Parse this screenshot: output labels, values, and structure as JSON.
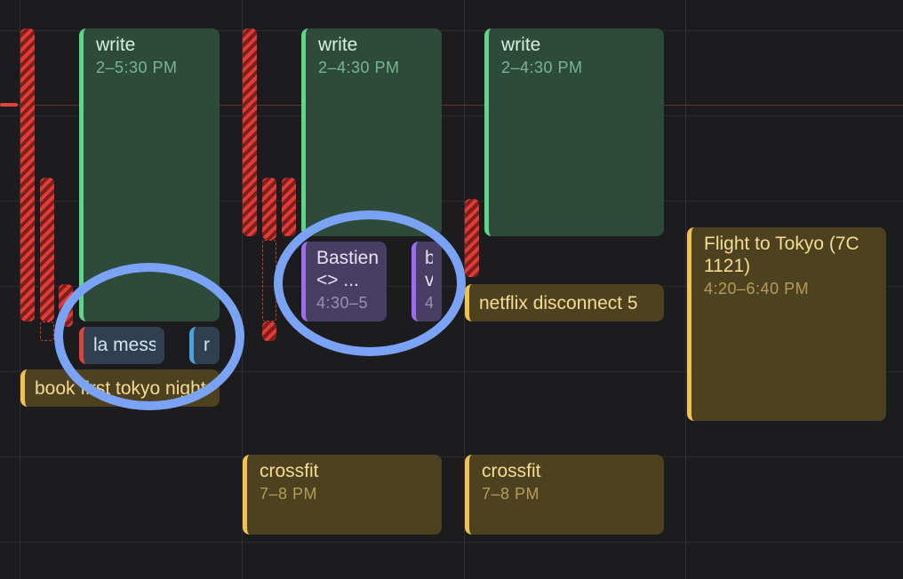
{
  "columns": [
    {
      "events": [
        {
          "title": "write",
          "time": "2–5:30 PM"
        },
        {
          "title": "la messe"
        },
        {
          "title": "r"
        },
        {
          "title": "book first tokyo night"
        }
      ]
    },
    {
      "events": [
        {
          "title": "write",
          "time": "2–4:30 PM"
        },
        {
          "title": "Bastien <> ...",
          "time": "4:30–5"
        },
        {
          "title": "b v",
          "time": "4"
        },
        {
          "title": "crossfit",
          "time": "7–8 PM"
        }
      ]
    },
    {
      "events": [
        {
          "title": "write",
          "time": "2–4:30 PM"
        },
        {
          "title": "netflix disconnect 5"
        },
        {
          "title": "crossfit",
          "time": "7–8 PM"
        }
      ]
    },
    {
      "events": [
        {
          "title": "Flight to Tokyo (7C 1121)",
          "time": "4:20–6:40 PM"
        }
      ]
    }
  ],
  "colors": {
    "background": "#1c1c1e",
    "green_accent": "#5dd68a",
    "yellow_accent": "#f2c14e",
    "purple_accent": "#9b6bf0",
    "red_accent": "#e0443e",
    "blue_accent": "#4aa3df",
    "annotation_circle": "#7aa3f5"
  }
}
